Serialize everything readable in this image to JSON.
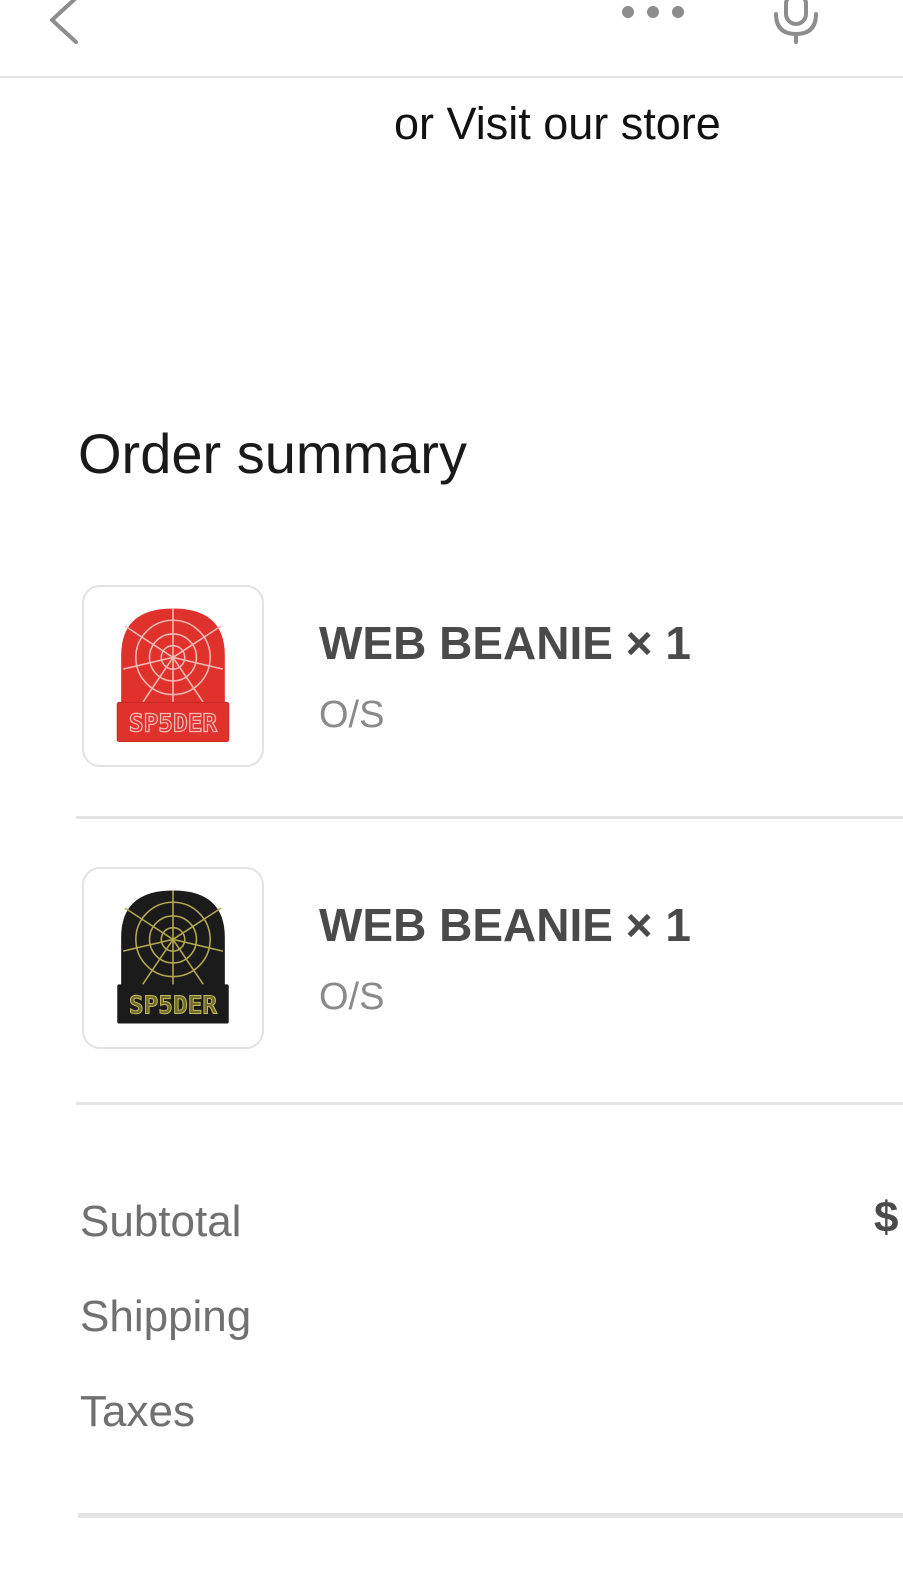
{
  "header": {
    "back_icon": "chevron-left-icon",
    "more_icon": "more-horizontal-icon",
    "mic_icon": "microphone-icon"
  },
  "visit_store_text": "or Visit our store",
  "order_summary": {
    "title": "Order summary",
    "items": [
      {
        "name": "WEB BEANIE × 1",
        "variant": "O/S",
        "image": "red-web-beanie-image",
        "image_colors": {
          "body": "#e0322c",
          "web": "#f3b9b4",
          "logo_text": "SP5DER"
        }
      },
      {
        "name": "WEB BEANIE × 1",
        "variant": "O/S",
        "image": "black-web-beanie-image",
        "image_colors": {
          "body": "#1b1b1b",
          "web": "#b3a84e",
          "logo_text": "SP5DER"
        }
      }
    ],
    "costs": [
      {
        "label": "Subtotal",
        "value": "$"
      },
      {
        "label": "Shipping",
        "value": ""
      },
      {
        "label": "Taxes",
        "value": ""
      }
    ]
  }
}
